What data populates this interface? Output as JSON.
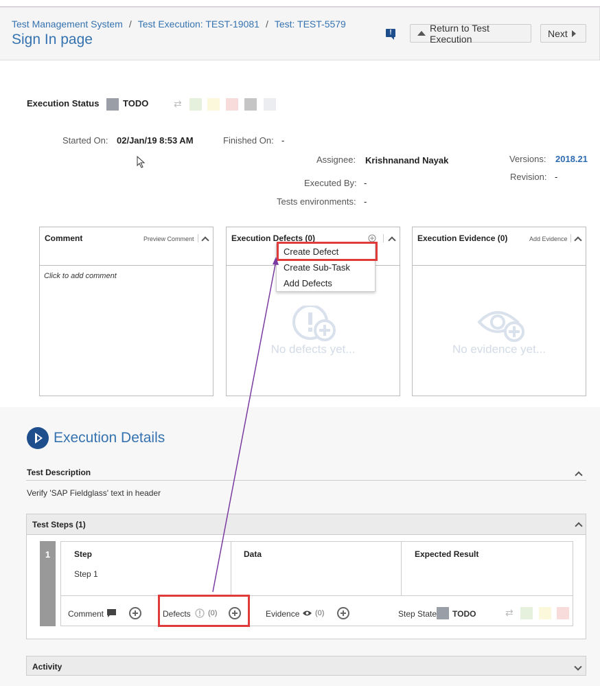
{
  "breadcrumb": [
    "Test Management System",
    "Test Execution: TEST-19081",
    "Test: TEST-5579"
  ],
  "breadcrumb_separator": "/",
  "page_title": "Sign In page",
  "header_buttons": {
    "return_label": "Return to Test Execution",
    "next_label": "Next"
  },
  "feedback_glyph": "!",
  "execution_status": {
    "label": "Execution Status",
    "value": "TODO",
    "color": "#9a9ea6",
    "swatches": [
      "#e5f1dd",
      "#fbf8dc",
      "#f8dcdc",
      "#c5c5c5",
      "#ecedf0"
    ]
  },
  "meta": {
    "started_on_label": "Started On:",
    "started_on": "02/Jan/19 8:53 AM",
    "finished_on_label": "Finished On:",
    "finished_on": "-",
    "assignee_label": "Assignee:",
    "assignee": "Krishnanand Nayak",
    "executed_by_label": "Executed By:",
    "executed_by": "-",
    "environments_label": "Tests environments:",
    "environments": "-",
    "versions_label": "Versions:",
    "versions": "2018.21",
    "revision_label": "Revision:",
    "revision": "-"
  },
  "panels": {
    "comment": {
      "title": "Comment",
      "action": "Preview Comment",
      "placeholder": "Click to add comment"
    },
    "defects": {
      "title": "Execution Defects (0)",
      "empty": "No defects yet..."
    },
    "evidence": {
      "title": "Execution Evidence (0)",
      "action": "Add Evidence",
      "empty": "No evidence yet..."
    }
  },
  "defect_menu": [
    "Create Defect",
    "Create Sub-Task",
    "Add Defects"
  ],
  "execution_details": {
    "title": "Execution Details",
    "test_description_label": "Test Description",
    "test_description": "Verify 'SAP Fieldglass' text in header",
    "test_steps_label": "Test Steps (1)",
    "activity_label": "Activity"
  },
  "step": {
    "number": "1",
    "columns": [
      "Step",
      "Data",
      "Expected Result"
    ],
    "step_text": "Step 1",
    "comment_label": "Comment",
    "defects_label": "Defects",
    "defects_count": "(0)",
    "evidence_label": "Evidence",
    "evidence_count": "(0)",
    "step_state_label": "Step State",
    "step_state": "TODO",
    "state_swatches": [
      "#e5f1dd",
      "#fbf8dc",
      "#f8dcdc"
    ]
  },
  "annotation_color": "#7a3aa0",
  "highlight_color": "#e03b3b"
}
